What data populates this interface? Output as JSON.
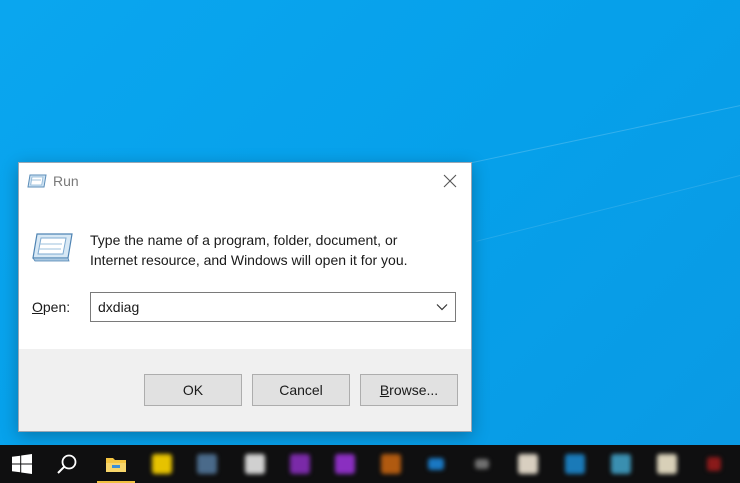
{
  "dialog": {
    "title": "Run",
    "description_line1": "Type the name of a program, folder, document, or",
    "description_line2": "Internet resource, and Windows will open it for you.",
    "open_label_accel": "O",
    "open_label_rest": "pen:",
    "open_value": "dxdiag",
    "buttons": {
      "ok": "OK",
      "cancel": "Cancel",
      "browse_accel": "B",
      "browse_rest": "rowse..."
    }
  },
  "taskbar": {
    "items": [
      {
        "icon": "windows-start-icon"
      },
      {
        "icon": "search-icon"
      },
      {
        "icon": "file-explorer-icon",
        "active": true
      },
      {
        "icon": "app-icon",
        "color": "#e6c200"
      },
      {
        "icon": "app-icon",
        "color": "#4a6a8a"
      },
      {
        "icon": "app-icon",
        "color": "#d0d0d0"
      },
      {
        "icon": "app-icon",
        "color": "#7a2aa8"
      },
      {
        "icon": "app-icon",
        "color": "#8a2fc0"
      },
      {
        "icon": "app-icon",
        "color": "#b05a10"
      },
      {
        "icon": "app-icon",
        "color": "#1a78c2"
      },
      {
        "icon": "app-icon",
        "color": "#707070"
      },
      {
        "icon": "app-icon",
        "color": "#d8cfc0"
      },
      {
        "icon": "app-icon",
        "color": "#1a7ab8"
      },
      {
        "icon": "app-icon",
        "color": "#3a8fb0"
      },
      {
        "icon": "app-icon",
        "color": "#d8d0b8"
      },
      {
        "icon": "app-icon",
        "color": "#8a1a1a"
      }
    ]
  },
  "colors": {
    "desktop": "#06a0ea",
    "taskbar": "#0f0f10",
    "dialog_footer": "#f0f0f0",
    "button_face": "#e1e1e1"
  }
}
